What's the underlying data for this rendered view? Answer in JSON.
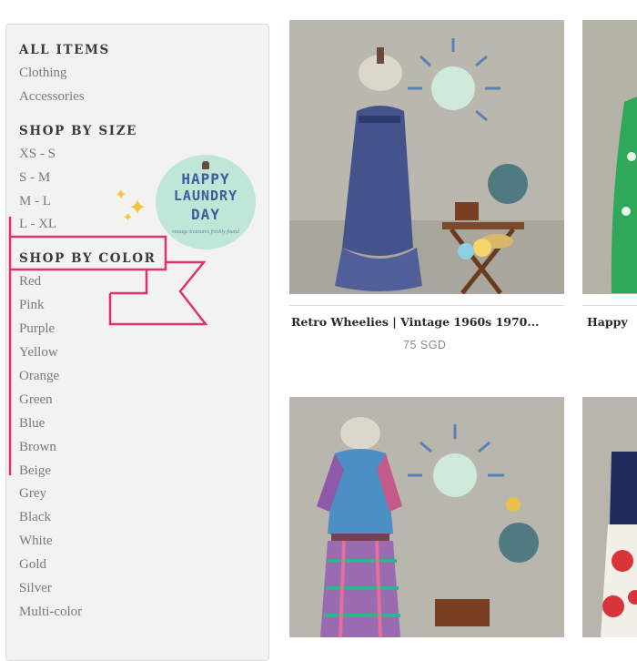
{
  "sidebar": {
    "all_items": {
      "title": "ALL ITEMS",
      "items": [
        "Clothing",
        "Accessories"
      ]
    },
    "size": {
      "title": "SHOP BY SIZE",
      "items": [
        "XS - S",
        "S - M",
        "M - L",
        "L - XL"
      ]
    },
    "color": {
      "title": "SHOP BY COLOR",
      "items": [
        "Red",
        "Pink",
        "Purple",
        "Yellow",
        "Orange",
        "Green",
        "Blue",
        "Brown",
        "Beige",
        "Grey",
        "Black",
        "White",
        "Gold",
        "Silver",
        "Multi-color"
      ]
    }
  },
  "logo": {
    "line1": "HAPPY",
    "line2": "LAUNDRY",
    "line3": "DAY",
    "tagline": "vintage treasures freshly found"
  },
  "annotation": {
    "color": "#e0336b",
    "icon": "ribbon-banner-icon",
    "sparkle_icon": "sparkle-icon"
  },
  "products": [
    {
      "title": "Retro Wheelies | Vintage 1960s 1970...",
      "price": "75 SGD"
    },
    {
      "title": "Happy",
      "price": ""
    }
  ],
  "colors": {
    "sidebar_bg": "#f2f2f0",
    "logo_bg": "#bfe6d6",
    "heading": "#3a3a3a",
    "link": "#7a7a7a"
  }
}
